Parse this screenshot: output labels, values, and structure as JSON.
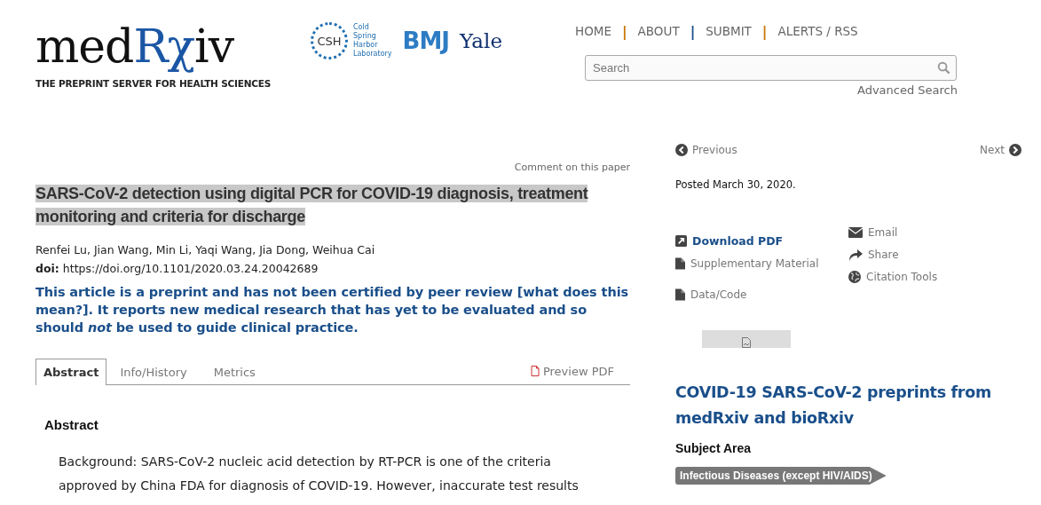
{
  "header": {
    "logo": {
      "segments": [
        {
          "text": "med",
          "accent": false
        },
        {
          "text": "Rχ",
          "accent": true
        },
        {
          "text": "iv",
          "accent": false
        }
      ],
      "tagline": "THE PREPRINT SERVER FOR HEALTH SCIENCES"
    },
    "partners": [
      {
        "kind": "csh",
        "badge": "CSH",
        "lines": [
          "Cold",
          "Spring",
          "Harbor",
          "Laboratory"
        ]
      },
      {
        "kind": "bmj",
        "text": "BMJ"
      },
      {
        "kind": "yale",
        "text": "Yale"
      }
    ],
    "nav": [
      {
        "label": "HOME"
      },
      {
        "separator": "|",
        "color": "#c8780a"
      },
      {
        "label": "ABOUT"
      },
      {
        "separator": "|",
        "color": "#1a4f8a"
      },
      {
        "label": "SUBMIT"
      },
      {
        "separator": "|",
        "color": "#c8780a"
      },
      {
        "label": "ALERTS / RSS"
      }
    ],
    "search": {
      "placeholder": "Search"
    },
    "advanced_search": "Advanced Search"
  },
  "article": {
    "comment_link": "Comment on this paper",
    "title": "SARS-CoV-2 detection using digital PCR for COVID-19 diagnosis, treatment monitoring and criteria for discharge",
    "title_highlighted": true,
    "authors": "Renfei Lu, Jian Wang, Min Li, Yaqi Wang, Jia Dong, Weihua Cai",
    "doi_label": "doi:",
    "doi": "https://doi.org/10.1101/2020.03.24.20042689",
    "notice": "This article is a preprint and has not been certified by peer review [what does this mean?]. It reports new medical research that has yet to be evaluated and so should *not* be used to guide clinical practice.",
    "tabs": [
      {
        "label": "Abstract",
        "selected": true
      },
      {
        "label": "Info/History",
        "selected": false
      },
      {
        "label": "Metrics",
        "selected": false
      }
    ],
    "preview_pdf": "Preview PDF",
    "abstract_heading": "Abstract",
    "abstract_lines": [
      "Background: SARS-CoV-2 nucleic acid detection by RT-PCR is one of the criteria",
      "approved by China FDA for diagnosis of COVID-19. However, inaccurate test results"
    ]
  },
  "sidebar": {
    "previous": "Previous",
    "next": "Next",
    "posted": "Posted March 30, 2020.",
    "links_left": [
      {
        "kind": "download",
        "label": "Download PDF"
      },
      {
        "kind": "file",
        "label": "Supplementary Material"
      },
      {
        "kind": "file",
        "label": "Data/Code"
      }
    ],
    "links_right": [
      {
        "kind": "email",
        "label": "Email"
      },
      {
        "kind": "share",
        "label": "Share"
      },
      {
        "kind": "globe",
        "label": "Citation Tools"
      }
    ],
    "collection_title": "COVID-19 SARS-CoV-2 preprints from medRxiv and bioRxiv",
    "subject_heading": "Subject Area",
    "subject_tag": "Infectious Diseases (except HIV/AIDS)"
  }
}
